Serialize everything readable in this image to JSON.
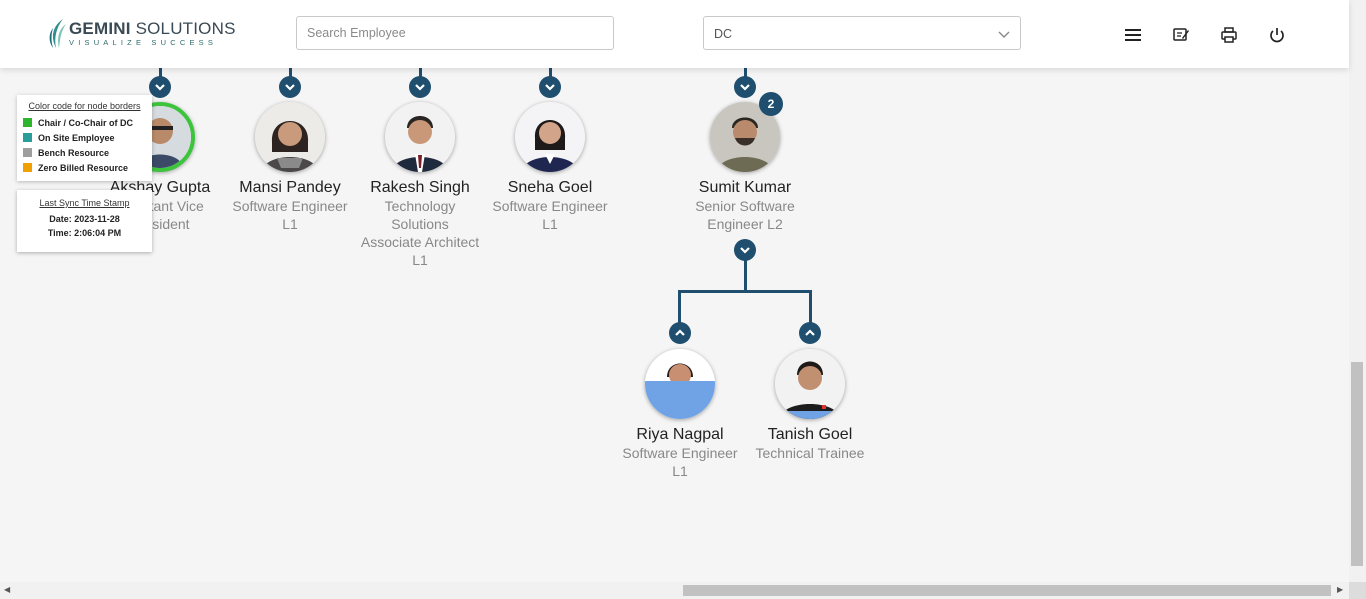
{
  "header": {
    "logo": {
      "brand": "GEMINI SOLUTIONS",
      "brand_bold": "GEMINI",
      "brand_rest": " SOLUTIONS",
      "tagline": "VISUALIZE SUCCESS"
    },
    "search": {
      "placeholder": "Search Employee",
      "value": ""
    },
    "dc_select": {
      "value": "DC"
    },
    "icons": [
      "menu-icon",
      "edit-note-icon",
      "print-icon",
      "power-icon"
    ]
  },
  "legend": {
    "title": "Color code for node borders",
    "items": [
      {
        "label": "Chair / Co-Chair of DC",
        "color": "#2db52d"
      },
      {
        "label": "On Site Employee",
        "color": "#2a9d9a"
      },
      {
        "label": "Bench Resource",
        "color": "#9e9e9e"
      },
      {
        "label": "Zero Billed Resource",
        "color": "#f0a000"
      }
    ]
  },
  "sync": {
    "title": "Last Sync Time Stamp",
    "date_label": "Date: 2023-11-28",
    "time_label": "Time: 2:06:04 PM"
  },
  "nodes": [
    {
      "name": "Akshay Gupta",
      "title_lines": [
        "Assistant Vice",
        "President"
      ],
      "border": "#3cc43c"
    },
    {
      "name": "Mansi Pandey",
      "title_lines": [
        "Software Engineer",
        "L1"
      ]
    },
    {
      "name": "Rakesh Singh",
      "title_lines": [
        "Technology",
        "Solutions",
        "Associate Architect",
        "L1"
      ]
    },
    {
      "name": "Sneha Goel",
      "title_lines": [
        "Software Engineer",
        "L1"
      ]
    },
    {
      "name": "Sumit Kumar",
      "title_lines": [
        "Senior Software",
        "Engineer L2"
      ],
      "badge": "2"
    },
    {
      "name": "Riya Nagpal",
      "title_lines": [
        "Software Engineer",
        "L1"
      ]
    },
    {
      "name": "Tanish Goel",
      "title_lines": [
        "Technical Trainee"
      ]
    }
  ],
  "colors": {
    "accent": "#1f4e6e"
  }
}
